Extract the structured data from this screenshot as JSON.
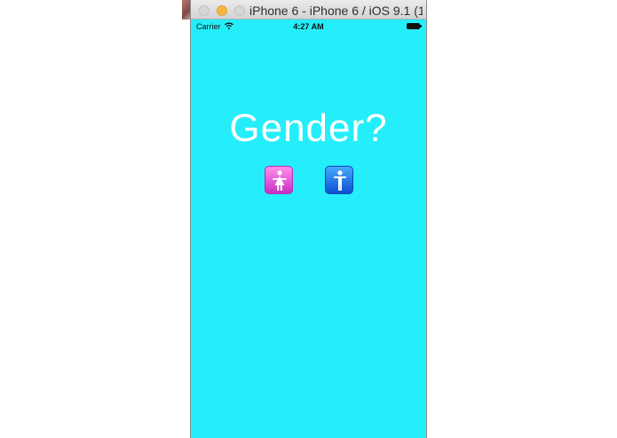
{
  "window": {
    "title": "iPhone 6 - iPhone 6 / iOS 9.1 (1"
  },
  "statusbar": {
    "carrier": "Carrier",
    "time": "4:27 AM",
    "icons": [
      "wifi-icon",
      "battery-icon"
    ]
  },
  "screen": {
    "background_color": "#25eefb",
    "question": "Gender?",
    "options": [
      {
        "label": "female",
        "icon": "womens-symbol-icon",
        "color": "#e04fdc"
      },
      {
        "label": "male",
        "icon": "mens-symbol-icon",
        "color": "#1a6ee8"
      }
    ]
  }
}
